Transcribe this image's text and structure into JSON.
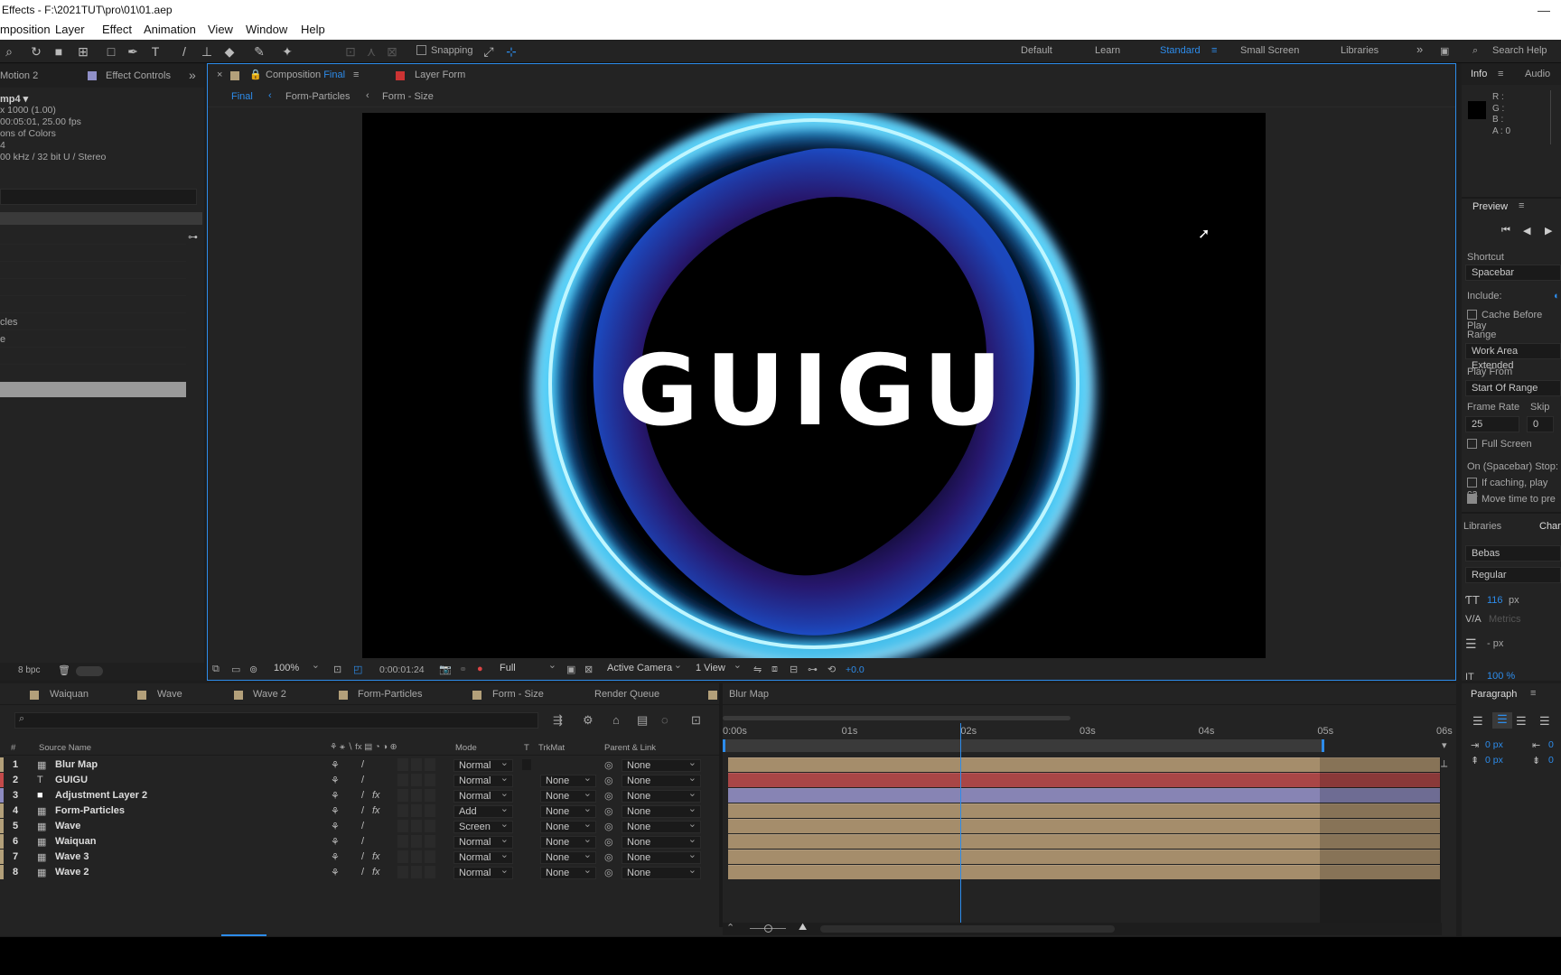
{
  "window": {
    "title": "Effects - F:\\2021TUT\\pro\\01\\01.aep",
    "close": "—"
  },
  "menu": [
    "mposition",
    "Layer",
    "Effect",
    "Animation",
    "View",
    "Window",
    "Help"
  ],
  "toolbar": {
    "snapping_label": "Snapping",
    "workspaces": [
      "Default",
      "Learn",
      "Standard",
      "Small Screen",
      "Libraries"
    ],
    "active_workspace": "Standard",
    "search_help": "Search Help"
  },
  "project": {
    "tabs": [
      "Motion 2",
      "Effect Controls"
    ],
    "file_name": "mp4 ▾",
    "info_lines": [
      "x 1000 (1.00)",
      "00:05:01, 25.00 fps",
      "ons of Colors",
      "4",
      "00 kHz / 32 bit U / Stereo"
    ],
    "list_items": [
      "cles",
      "e"
    ],
    "bpc": "8 bpc"
  },
  "composition": {
    "tabs": [
      {
        "prefix": "Composition",
        "name": "Final"
      },
      {
        "prefix": "Layer",
        "name": "Form"
      }
    ],
    "breadcrumbs": [
      "Final",
      "Form-Particles",
      "Form - Size"
    ],
    "viewer_text": "GUIGU",
    "footer": {
      "zoom": "100%",
      "timecode": "0:00:01:24",
      "resolution": "Full",
      "camera": "Active Camera",
      "views": "1 View",
      "exposure": "+0.0"
    }
  },
  "info_panel": {
    "tabs": [
      "Info",
      "Audio"
    ],
    "channels": [
      "R :",
      "G :",
      "B :",
      "A : 0"
    ]
  },
  "preview_panel": {
    "title": "Preview",
    "shortcut_label": "Shortcut",
    "shortcut_value": "Spacebar",
    "include_label": "Include:",
    "cache_label": "Cache Before Play",
    "range_label": "Range",
    "range_value": "Work Area Extended",
    "play_from_label": "Play From",
    "play_from_value": "Start Of Range",
    "frame_rate_label": "Frame Rate",
    "skip_label": "Skip",
    "frame_rate_value": "25",
    "skip_value": "0",
    "full_screen_label": "Full Screen",
    "on_stop_label": "On (Spacebar) Stop:",
    "if_caching_label": "If caching, play ca",
    "move_time_label": "Move time to pre"
  },
  "character_panel": {
    "tabs": [
      "Libraries",
      "Char"
    ],
    "font": "Bebas",
    "style": "Regular",
    "size": "116",
    "size_unit": "px",
    "tracking": "Metrics",
    "leading_unit": "- px",
    "scale": "100 %"
  },
  "paragraph_panel": {
    "title": "Paragraph",
    "indent_left": "0 px",
    "indent_right": "0",
    "space_before": "0 px",
    "space_after": "0"
  },
  "timeline": {
    "tabs": [
      "Waiquan",
      "Wave",
      "Wave 2",
      "Form-Particles",
      "Form - Size",
      "Render Queue",
      "Blur Map"
    ],
    "tab_colors": [
      "#b3a07a",
      "#b3a07a",
      "#b3a07a",
      "#b3a07a",
      "#b3a07a",
      "",
      "#b3a07a"
    ],
    "search_placeholder": "",
    "headers": {
      "num": "#",
      "source": "Source Name",
      "mode": "Mode",
      "t": "T",
      "trkmat": "TrkMat",
      "parent": "Parent & Link"
    },
    "ruler": [
      "0:00s",
      "01s",
      "02s",
      "03s",
      "04s",
      "05s",
      "06s"
    ],
    "current_time_fraction": 0.333,
    "layers": [
      {
        "num": "1",
        "name": "Blur Map",
        "mode": "Normal",
        "trkmat": "",
        "parent": "None",
        "color": "#b3a07a",
        "bar": "#a58d6b",
        "icon": "comp",
        "fx": false
      },
      {
        "num": "2",
        "name": "GUIGU",
        "mode": "Normal",
        "trkmat": "None",
        "parent": "None",
        "color": "#c34a4a",
        "bar": "#a94646",
        "icon": "text",
        "fx": false
      },
      {
        "num": "3",
        "name": "Adjustment Layer 2",
        "mode": "Normal",
        "trkmat": "None",
        "parent": "None",
        "color": "#8d8bc0",
        "bar": "#8784b4",
        "icon": "solid",
        "fx": true
      },
      {
        "num": "4",
        "name": "Form-Particles",
        "mode": "Add",
        "trkmat": "None",
        "parent": "None",
        "color": "#b3a07a",
        "bar": "#a58d6b",
        "icon": "comp",
        "fx": true
      },
      {
        "num": "5",
        "name": "Wave",
        "mode": "Screen",
        "trkmat": "None",
        "parent": "None",
        "color": "#b3a07a",
        "bar": "#a58d6b",
        "icon": "comp",
        "fx": false
      },
      {
        "num": "6",
        "name": "Waiquan",
        "mode": "Normal",
        "trkmat": "None",
        "parent": "None",
        "color": "#b3a07a",
        "bar": "#a58d6b",
        "icon": "comp",
        "fx": false
      },
      {
        "num": "7",
        "name": "Wave 3",
        "mode": "Normal",
        "trkmat": "None",
        "parent": "None",
        "color": "#b3a07a",
        "bar": "#a58d6b",
        "icon": "comp",
        "fx": true
      },
      {
        "num": "8",
        "name": "Wave 2",
        "mode": "Normal",
        "trkmat": "None",
        "parent": "None",
        "color": "#b3a07a",
        "bar": "#a58d6b",
        "icon": "comp",
        "fx": true
      }
    ]
  },
  "colors": {
    "accent": "#2d8ceb",
    "panel_bg": "#232323",
    "viewer_bg": "#000000"
  }
}
